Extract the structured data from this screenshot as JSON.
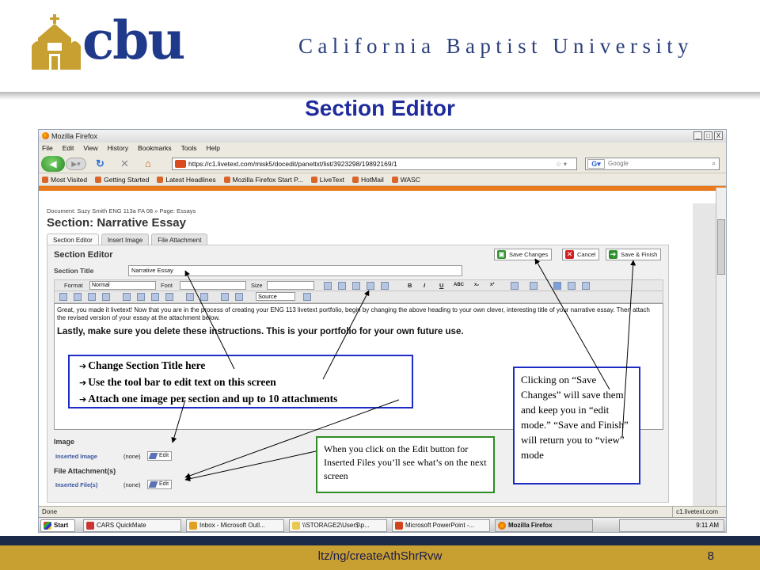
{
  "logo": {
    "text": "cbu"
  },
  "university_name": "California Baptist University",
  "slide_title": "Section Editor",
  "browser": {
    "window_title": "Mozilla Firefox",
    "window_buttons": [
      "_",
      "□",
      "X"
    ],
    "menu": [
      "File",
      "Edit",
      "View",
      "History",
      "Bookmarks",
      "Tools",
      "Help"
    ],
    "url": "https://c1.livetext.com/misk5/docedit/paneltxt/list/3923298/19892169/1",
    "search_placeholder": "Google",
    "bookmarks": [
      "Most Visited",
      "Getting Started",
      "Latest Headlines",
      "Mozilla Firefox Start P...",
      "LiveText",
      "HotMail",
      "WASC"
    ],
    "status_left": "Done",
    "status_right": "c1.livetext.com"
  },
  "page": {
    "breadcrumb": "Document: Suzy Smith ENG 113a FA 08   »  Page: Essays",
    "section_heading": "Section: Narrative Essay",
    "tabs": [
      "Section Editor",
      "Insert Image",
      "File Attachment"
    ],
    "editor_label": "Section Editor",
    "buttons": {
      "save_changes": "Save Changes",
      "cancel": "Cancel",
      "save_finish": "Save & Finish"
    },
    "section_title_label": "Section Title",
    "section_title_value": "Narrative Essay",
    "toolbar": {
      "format_label": "Format",
      "format_value": "Normal",
      "font_label": "Font",
      "size_label": "Size",
      "source_label": "Source"
    },
    "body_paragraph": "Great, you made it livetext! Now that you are in the process of creating your ENG 113 livetext portfolio, begin by changing the above heading to your own clever, interesting title of your narrative essay. Then attach the revised version of your essay at the attachment below.",
    "body_bold": "Lastly, make sure you delete these instructions.  This is your portfolio for your own future use.",
    "image_section": "Image",
    "inserted_image_label": "Inserted Image",
    "inserted_image_value": "(none)",
    "attachments_section": "File Attachment(s)",
    "inserted_files_label": "Inserted File(s)",
    "inserted_files_value": "(none)",
    "edit_label": "Edit"
  },
  "taskbar": {
    "start": "Start",
    "items": [
      "CARS QuickMate",
      "Inbox - Microsoft Outl...",
      "\\\\STORAGE2\\User$\\p...",
      "Microsoft PowerPoint -...",
      "Mozilla Firefox"
    ],
    "clock": "9:11 AM"
  },
  "callouts": {
    "tips": [
      "Change Section Title here",
      "Use the tool bar to edit text on this screen",
      "Attach one image per section and up to 10 attachments"
    ],
    "edit_note": "When you click on the Edit button for Inserted Files you’ll see what’s on the next screen",
    "save_note": "Clicking on “Save Changes” will save them and keep you in “edit mode.”   “Save and Finish” will return you to “view” mode"
  },
  "footer": {
    "path": "ltz/ng/createAthShrRvw",
    "page_number": "8"
  },
  "colors": {
    "title_blue": "#1f2c9c",
    "logo_blue": "#1f3a8a",
    "logo_gold": "#c8a032",
    "footer_navy": "#1c2a4a",
    "callout_blue": "#1d2cc4",
    "callout_green": "#2e8b25"
  }
}
